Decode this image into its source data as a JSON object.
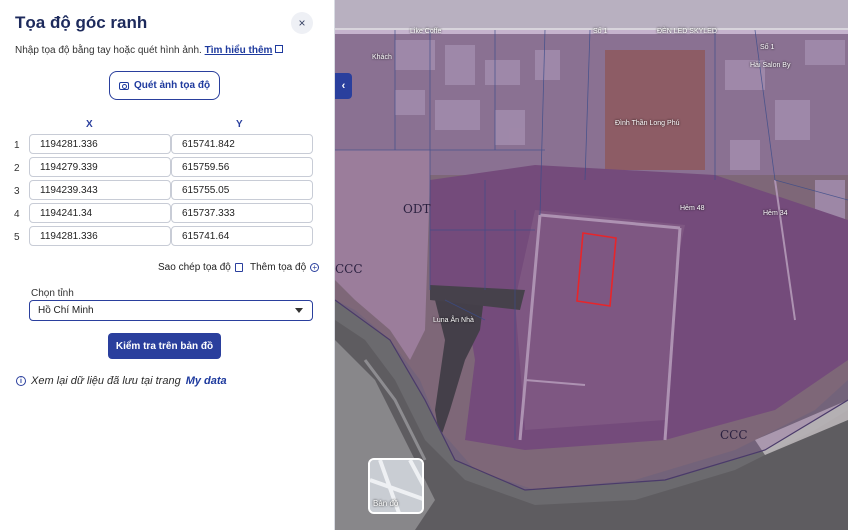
{
  "panel": {
    "title": "Tọa độ góc ranh",
    "close_icon": "×",
    "instruction": "Nhập tọa độ bằng tay hoặc quét hình ảnh.",
    "learn_more": "Tìm hiểu thêm",
    "scan_button": "Quét ảnh tọa độ",
    "col_x": "X",
    "col_y": "Y",
    "rows": [
      {
        "num": "1",
        "x": "1194281.336",
        "y": "615741.842"
      },
      {
        "num": "2",
        "x": "1194279.339",
        "y": "615759.56"
      },
      {
        "num": "3",
        "x": "1194239.343",
        "y": "615755.05"
      },
      {
        "num": "4",
        "x": "1194241.34",
        "y": "615737.333"
      },
      {
        "num": "5",
        "x": "1194281.336",
        "y": "615741.64"
      }
    ],
    "copy_label": "Sao chép tọa độ",
    "add_label": "Thêm tọa độ",
    "province_label": "Chọn tỉnh",
    "province_value": "Hồ Chí Minh",
    "check_button": "Kiểm tra trên bản đồ",
    "info_text": "Xem lại dữ liệu đã lưu tại trang",
    "my_data": "My data",
    "accent_color": "#2a3f9d"
  },
  "map": {
    "collapse_icon": "‹",
    "labels": {
      "like_coffee": "Like Coffe",
      "so1_a": "Số 1",
      "den_led": "ĐÈN LED SKYLED",
      "so1_b": "Số 1",
      "hai_salon": "Hải Salon By",
      "dinh_than": "Đình Thần Long Phú",
      "hem48": "Hẻm 48",
      "hem34": "Hẻm 34",
      "luna_nha": "Luna Ân Nhà",
      "khach": "Khách"
    },
    "zones": {
      "odt": "ODT",
      "ccc_left": "CCC",
      "ccc_bottom": "CCC"
    },
    "basemap_label": "Bản đồ",
    "parcel_color": "#e8252a",
    "overlay_color": "#8a4fa0"
  }
}
